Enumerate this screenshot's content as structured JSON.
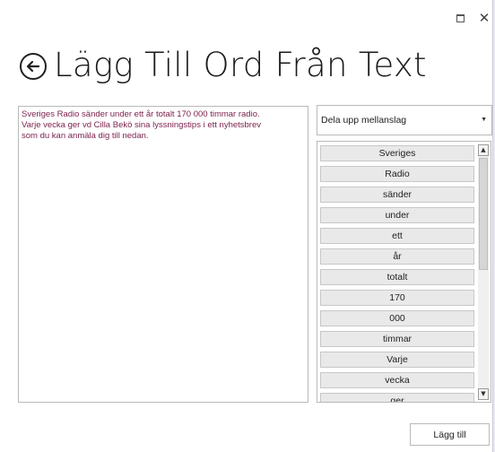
{
  "window": {
    "title": "Lägg Till Ord Från Text",
    "maximize_glyph": "",
    "close_glyph": "✕"
  },
  "icons": {
    "back": "back-arrow-circle-icon",
    "maximize": "maximize-icon",
    "close": "close-icon",
    "dropdown": "chevron-down-icon",
    "scroll_up": "scroll-up-icon",
    "scroll_down": "scroll-down-icon"
  },
  "input": {
    "text": "Sveriges Radio sänder under ett år totalt 170 000 timmar radio.\nVarje vecka ger vd Cilla Bekö sina lyssningstips i ett nyhetsbrev\nsom du kan anmäla dig till nedan."
  },
  "split_mode": {
    "selected": "Dela upp mellanslag"
  },
  "words": [
    "Sveriges",
    "Radio",
    "sänder",
    "under",
    "ett",
    "år",
    "totalt",
    "170",
    "000",
    "timmar",
    "Varje",
    "vecka",
    "ger"
  ],
  "footer": {
    "add_label": "Lägg till"
  },
  "colors": {
    "text_accent": "#7a1f4a",
    "word_bg": "#e9e9e9"
  }
}
